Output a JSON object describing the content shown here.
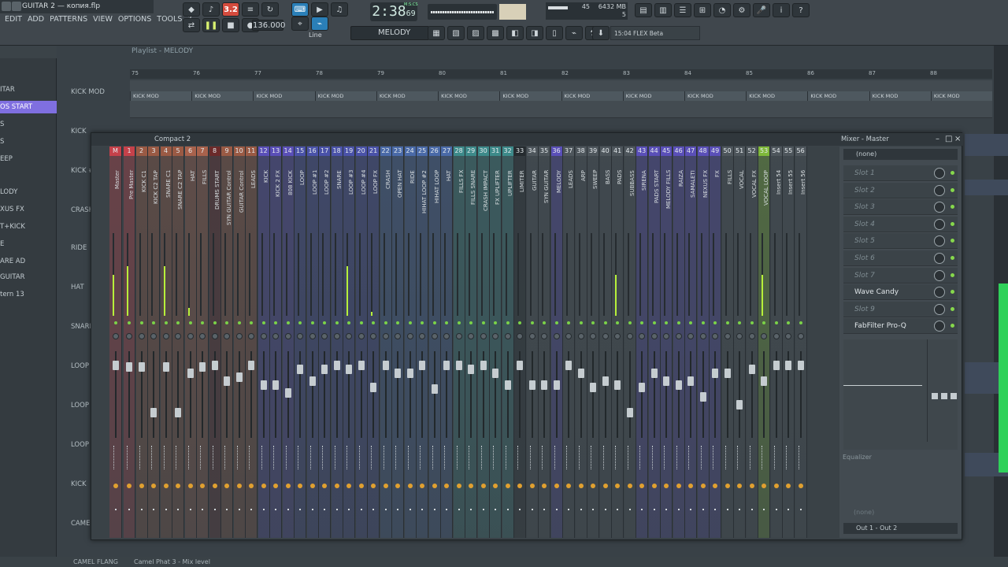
{
  "titlebar": {
    "title": "GUITAR 2 — копия.flp"
  },
  "menu": [
    "EDIT",
    "ADD",
    "PATTERNS",
    "VIEW",
    "OPTIONS",
    "TOOLS",
    "?"
  ],
  "transport": {
    "time": "2:38",
    "time_sub": "69",
    "time_unit": "M:S:CS",
    "tempo": "136.000",
    "pattern": "MELODY",
    "snap": "Line",
    "rec_badge": "3.2"
  },
  "cpu": {
    "cpu_value": "45",
    "memory": "6432 MB",
    "voices": "5"
  },
  "hint": {
    "text": "15:04  FLEX Beta"
  },
  "browser": {
    "items": [
      "ITAR",
      "OS START",
      "S",
      "S",
      "EEP",
      "LODY",
      "XUS FX",
      "T+KICK",
      "E",
      "ARE AD",
      "GUITAR",
      "tern 13"
    ]
  },
  "playlist": {
    "title": "Playlist - MELODY",
    "bars": [
      "75",
      "76",
      "77",
      "78",
      "79",
      "80",
      "81",
      "82",
      "83",
      "84",
      "85",
      "86",
      "87",
      "88"
    ],
    "tracks": [
      "KICK MOD",
      "KICK",
      "KICK #",
      "CRASH",
      "RIDE",
      "HAT",
      "SNARE",
      "LOOP",
      "LOOP",
      "LOOP",
      "KICK",
      "CAMEL"
    ],
    "clip_label": "KICK MOD",
    "bottom_track": "CAMEL FLANG"
  },
  "status": {
    "text": "Camel Phat 3 - Mix level"
  },
  "mixer": {
    "preset": "Compact 2",
    "title": "Mixer - Master",
    "fx_preset": "(none)",
    "slots": [
      {
        "label": "Slot 1",
        "active": false
      },
      {
        "label": "Slot 2",
        "active": false
      },
      {
        "label": "Slot 3",
        "active": false
      },
      {
        "label": "Slot 4",
        "active": false
      },
      {
        "label": "Slot 5",
        "active": false
      },
      {
        "label": "Slot 6",
        "active": false
      },
      {
        "label": "Slot 7",
        "active": false
      },
      {
        "label": "Wave Candy",
        "active": true
      },
      {
        "label": "Slot 9",
        "active": false
      },
      {
        "label": "FabFilter Pro-Q",
        "active": true
      }
    ],
    "eq_label": "Equalizer",
    "bottom_preset": "(none)",
    "output": "Out 1 - Out 2",
    "channels": [
      {
        "num": "M",
        "name": "Master",
        "color": "#c5414a",
        "meter": 0.5,
        "fader": 0.0
      },
      {
        "num": "1",
        "name": "Pre Master",
        "color": "#c5414a",
        "meter": 0.6,
        "fader": 0.02
      },
      {
        "num": "2",
        "name": "KICK C1",
        "color": "#9a5a44",
        "meter": 0.0,
        "fader": 0.02
      },
      {
        "num": "3",
        "name": "KICK C2 TAP",
        "color": "#9a5a44",
        "meter": 0.0,
        "fader": 0.6
      },
      {
        "num": "4",
        "name": "SNARE C1",
        "color": "#9a5a44",
        "meter": 0.6,
        "fader": 0.02
      },
      {
        "num": "5",
        "name": "SNARE C2 TAP",
        "color": "#9a5a44",
        "meter": 0.0,
        "fader": 0.6
      },
      {
        "num": "6",
        "name": "HAT",
        "color": "#a8624c",
        "meter": 0.1,
        "fader": 0.1
      },
      {
        "num": "7",
        "name": "FILLS",
        "color": "#a8624c",
        "meter": 0.0,
        "fader": 0.02
      },
      {
        "num": "8",
        "name": "DRUMS START",
        "color": "#6b2a2a",
        "meter": 0.0,
        "fader": 0.0
      },
      {
        "num": "9",
        "name": "SYN GUITAR Control",
        "color": "#9a5a44",
        "meter": 0.0,
        "fader": 0.2
      },
      {
        "num": "10",
        "name": "GUITAR Control",
        "color": "#9a5a44",
        "meter": 0.0,
        "fader": 0.15
      },
      {
        "num": "11",
        "name": "LEADS",
        "color": "#9a5a44",
        "meter": 0.0,
        "fader": 0.0
      },
      {
        "num": "12",
        "name": "KICK",
        "color": "#5a4fb8",
        "meter": 0.0,
        "fader": 0.25
      },
      {
        "num": "13",
        "name": "KICK 2 FX",
        "color": "#5a4fb8",
        "meter": 0.0,
        "fader": 0.25
      },
      {
        "num": "14",
        "name": "808 KICK",
        "color": "#5a4fb8",
        "meter": 0.0,
        "fader": 0.35
      },
      {
        "num": "15",
        "name": "LOOP",
        "color": "#4a52a8",
        "meter": 0.0,
        "fader": 0.05
      },
      {
        "num": "16",
        "name": "LOOP #1",
        "color": "#4a52a8",
        "meter": 0.0,
        "fader": 0.2
      },
      {
        "num": "17",
        "name": "LOOP #2",
        "color": "#4a52a8",
        "meter": 0.0,
        "fader": 0.05
      },
      {
        "num": "18",
        "name": "SNARE",
        "color": "#4a52a8",
        "meter": 0.0,
        "fader": 0.0
      },
      {
        "num": "19",
        "name": "LOOP #3",
        "color": "#4a52a8",
        "meter": 0.6,
        "fader": 0.05
      },
      {
        "num": "20",
        "name": "LOOP #4",
        "color": "#4a52a8",
        "meter": 0.0,
        "fader": 0.0
      },
      {
        "num": "21",
        "name": "LOOP FX",
        "color": "#4a52a8",
        "meter": 0.05,
        "fader": 0.28
      },
      {
        "num": "22",
        "name": "CRASH",
        "color": "#4a6aa8",
        "meter": 0.0,
        "fader": 0.0
      },
      {
        "num": "23",
        "name": "OPEN HAT",
        "color": "#4a6aa8",
        "meter": 0.0,
        "fader": 0.1
      },
      {
        "num": "24",
        "name": "RIDE",
        "color": "#4a6aa8",
        "meter": 0.0,
        "fader": 0.1
      },
      {
        "num": "25",
        "name": "HIHAT LOOP #2",
        "color": "#4a6aa8",
        "meter": 0.0,
        "fader": 0.0
      },
      {
        "num": "26",
        "name": "HIHAT LOOP",
        "color": "#4a6aa8",
        "meter": 0.0,
        "fader": 0.3
      },
      {
        "num": "27",
        "name": "HAT",
        "color": "#4a6aa8",
        "meter": 0.0,
        "fader": 0.0
      },
      {
        "num": "28",
        "name": "FILLS FX",
        "color": "#3d8a8a",
        "meter": 0.0,
        "fader": 0.0
      },
      {
        "num": "29",
        "name": "FILLS SNARE",
        "color": "#3d8a8a",
        "meter": 0.0,
        "fader": 0.05
      },
      {
        "num": "30",
        "name": "CRASH IMPACT",
        "color": "#3d8a8a",
        "meter": 0.0,
        "fader": 0.0
      },
      {
        "num": "31",
        "name": "FX UPLIFTER",
        "color": "#3d8a8a",
        "meter": 0.0,
        "fader": 0.1
      },
      {
        "num": "32",
        "name": "UPLIFTER",
        "color": "#3d8a8a",
        "meter": 0.0,
        "fader": 0.25
      },
      {
        "num": "33",
        "name": "LIMITER",
        "color": "#252b2f",
        "meter": 0.0,
        "fader": 0.0
      },
      {
        "num": "34",
        "name": "GUITAR",
        "color": "#4e565c",
        "meter": 0.0,
        "fader": 0.25
      },
      {
        "num": "35",
        "name": "SYN GUITAR",
        "color": "#4e565c",
        "meter": 0.0,
        "fader": 0.25
      },
      {
        "num": "36",
        "name": "MELODY",
        "color": "#5a4fb8",
        "meter": 0.0,
        "fader": 0.25
      },
      {
        "num": "37",
        "name": "LEADS",
        "color": "#4e565c",
        "meter": 0.0,
        "fader": 0.0
      },
      {
        "num": "38",
        "name": "ARP",
        "color": "#4e565c",
        "meter": 0.0,
        "fader": 0.1
      },
      {
        "num": "39",
        "name": "SWEEP",
        "color": "#4e565c",
        "meter": 0.0,
        "fader": 0.28
      },
      {
        "num": "40",
        "name": "BASS",
        "color": "#4e565c",
        "meter": 0.0,
        "fader": 0.2
      },
      {
        "num": "41",
        "name": "PADS",
        "color": "#4e565c",
        "meter": 0.5,
        "fader": 0.25
      },
      {
        "num": "42",
        "name": "SUBBASS",
        "color": "#4e565c",
        "meter": 0.0,
        "fader": 0.6
      },
      {
        "num": "43",
        "name": "SIRENA",
        "color": "#5a4fb8",
        "meter": 0.0,
        "fader": 0.28
      },
      {
        "num": "44",
        "name": "PADS START",
        "color": "#5a4fb8",
        "meter": 0.0,
        "fader": 0.1
      },
      {
        "num": "45",
        "name": "MELODY FILLS",
        "color": "#5a4fb8",
        "meter": 0.0,
        "fader": 0.2
      },
      {
        "num": "46",
        "name": "RAIZA",
        "color": "#5a4fb8",
        "meter": 0.0,
        "fader": 0.25
      },
      {
        "num": "47",
        "name": "SAMALETI",
        "color": "#5a4fb8",
        "meter": 0.0,
        "fader": 0.2
      },
      {
        "num": "48",
        "name": "NEXUS FX",
        "color": "#5a4fb8",
        "meter": 0.0,
        "fader": 0.4
      },
      {
        "num": "49",
        "name": "FX",
        "color": "#5a4fb8",
        "meter": 0.0,
        "fader": 0.1
      },
      {
        "num": "50",
        "name": "FILLS",
        "color": "#4e565c",
        "meter": 0.0,
        "fader": 0.1
      },
      {
        "num": "51",
        "name": "VOCAL",
        "color": "#4e565c",
        "meter": 0.0,
        "fader": 0.5
      },
      {
        "num": "52",
        "name": "VOCAL FX",
        "color": "#4e565c",
        "meter": 0.0,
        "fader": 0.05
      },
      {
        "num": "53",
        "name": "VOCAL LOOP",
        "color": "#7fb83a",
        "meter": 0.5,
        "fader": 0.2
      },
      {
        "num": "54",
        "name": "Insert 54",
        "color": "#4e565c",
        "meter": 0.0,
        "fader": 0.0
      },
      {
        "num": "55",
        "name": "Insert 55",
        "color": "#4e565c",
        "meter": 0.0,
        "fader": 0.0
      },
      {
        "num": "56",
        "name": "Insert 56",
        "color": "#4e565c",
        "meter": 0.0,
        "fader": 0.0
      }
    ]
  }
}
